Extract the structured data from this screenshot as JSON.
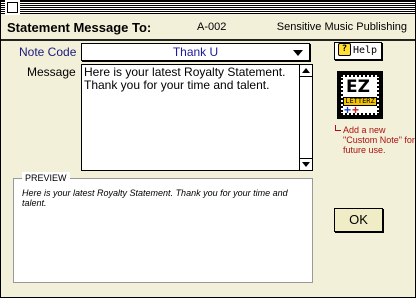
{
  "header": {
    "title": "Statement Message To:",
    "code": "A-002",
    "company": "Sensitive Music Publishing"
  },
  "note_code": {
    "label": "Note Code",
    "value": "Thank U"
  },
  "help_button": {
    "label": "Help",
    "icon": "question-icon"
  },
  "message": {
    "label": "Message",
    "text": "Here is your latest Royalty Statement. Thank you for your time and talent."
  },
  "ez_letterz": {
    "logo_text": "EZ",
    "logo_subtext": "LETTERZ",
    "note": "Add a new \"Custom Note\" for future use."
  },
  "preview": {
    "legend": "PREVIEW",
    "text": "Here is your latest Royalty Statement. Thank you for your time and talent."
  },
  "ok_button": {
    "label": "OK"
  },
  "colors": {
    "window_bg": "#f2f0d9",
    "label_blue": "#1a1a80",
    "note_red": "#aa1111"
  }
}
